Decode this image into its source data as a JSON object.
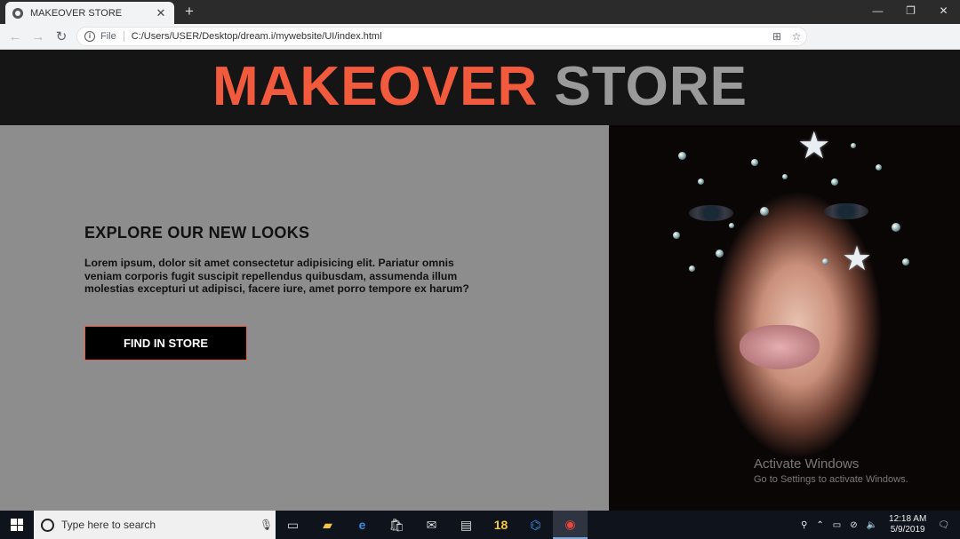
{
  "browser": {
    "tab_title": "MAKEOVER STORE",
    "tab_close": "✕",
    "new_tab": "+",
    "address_scheme": "File",
    "address_url": "C:/Users/USER/Desktop/dream.i/mywebsite/UI/index.html"
  },
  "site": {
    "brand_primary": "MAKEOVER",
    "brand_secondary": "STORE",
    "brand_primary_color": "#f15a3c",
    "brand_secondary_color": "#9a9a9a",
    "heading": "EXPLORE OUR NEW LOOKS",
    "paragraph": "Lorem ipsum, dolor sit amet consectetur adipisicing elit. Pariatur omnis veniam corporis fugit suscipit repellendus quibusdam, assumenda illum molestias excepturi ut adipisci, facere iure, amet porro tempore ex harum?",
    "button_label": "FIND IN STORE"
  },
  "watermark": {
    "line1": "Activate Windows",
    "line2": "Go to Settings to activate Windows."
  },
  "taskbar": {
    "search_placeholder": "Type here to search",
    "badge_count": "18",
    "time": "12:18 AM",
    "date": "5/9/2019"
  }
}
